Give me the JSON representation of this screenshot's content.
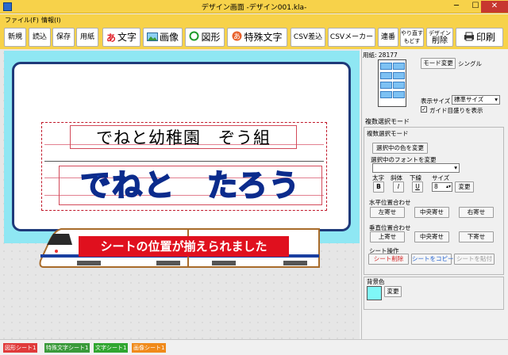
{
  "window": {
    "title": "デザイン画面 -デザイン001.kla-",
    "min": "─",
    "max": "☐",
    "close": "✕"
  },
  "menu": {
    "file": "ファイル(F)",
    "info": "情報(I)"
  },
  "toolbar": {
    "new": "新規",
    "open": "読込",
    "save": "保存",
    "paper": "用紙",
    "text": "文字",
    "image": "画像",
    "shape": "図形",
    "special": "特殊文字",
    "csv_insert": "CSV差込",
    "csv_maker": "CSVメーカー",
    "serial": "連番",
    "redo": "やり直す",
    "undo": "もどす",
    "design": "デザイン",
    "delete": "削除",
    "print": "印刷"
  },
  "design": {
    "line1": "でねと幼稚園　ぞう組",
    "line2": "でねと　たろう",
    "notice": "シートの位置が揃えられました"
  },
  "panel": {
    "paper_label": "用紙: 28177",
    "mode_change": "モード変更",
    "single": "シングル",
    "display_size_label": "表示サイズ",
    "display_size_value": "標準サイズ",
    "guide_label": "ガイド目盛りを表示",
    "mode_title": "複数選択モード",
    "group_title": "複数選択モード",
    "color_change": "選択中の色を変更",
    "font_change_label": "選択中のフォントを変更",
    "bold": "太字",
    "italic": "斜体",
    "underline": "下線",
    "size": "サイズ",
    "b": "B",
    "i": "I",
    "u": "U",
    "size_value": "8",
    "size_change": "変更",
    "horizontal_title": "水平位置合わせ",
    "left_align": "左寄せ",
    "center_h": "中央寄せ",
    "right_align": "右寄せ",
    "vertical_title": "垂直位置合わせ",
    "top_align": "上寄せ",
    "center_v": "中央寄せ",
    "bottom_align": "下寄せ",
    "sheet_op_title": "シート操作",
    "sheet_delete": "シート削除",
    "sheet_copy": "シートをコピー",
    "sheet_paste": "シートを貼付",
    "bg_title": "背景色",
    "bg_change": "変更",
    "bg_color": "#7ff7f7"
  },
  "status_tabs": [
    {
      "label": "図形シート1",
      "color": "#e03a3a"
    },
    {
      "label": "特殊文字シート1",
      "color": "#3a9a3a"
    },
    {
      "label": "文字シート1",
      "color": "#30a630"
    },
    {
      "label": "画像シート1",
      "color": "#f08a1a"
    }
  ]
}
